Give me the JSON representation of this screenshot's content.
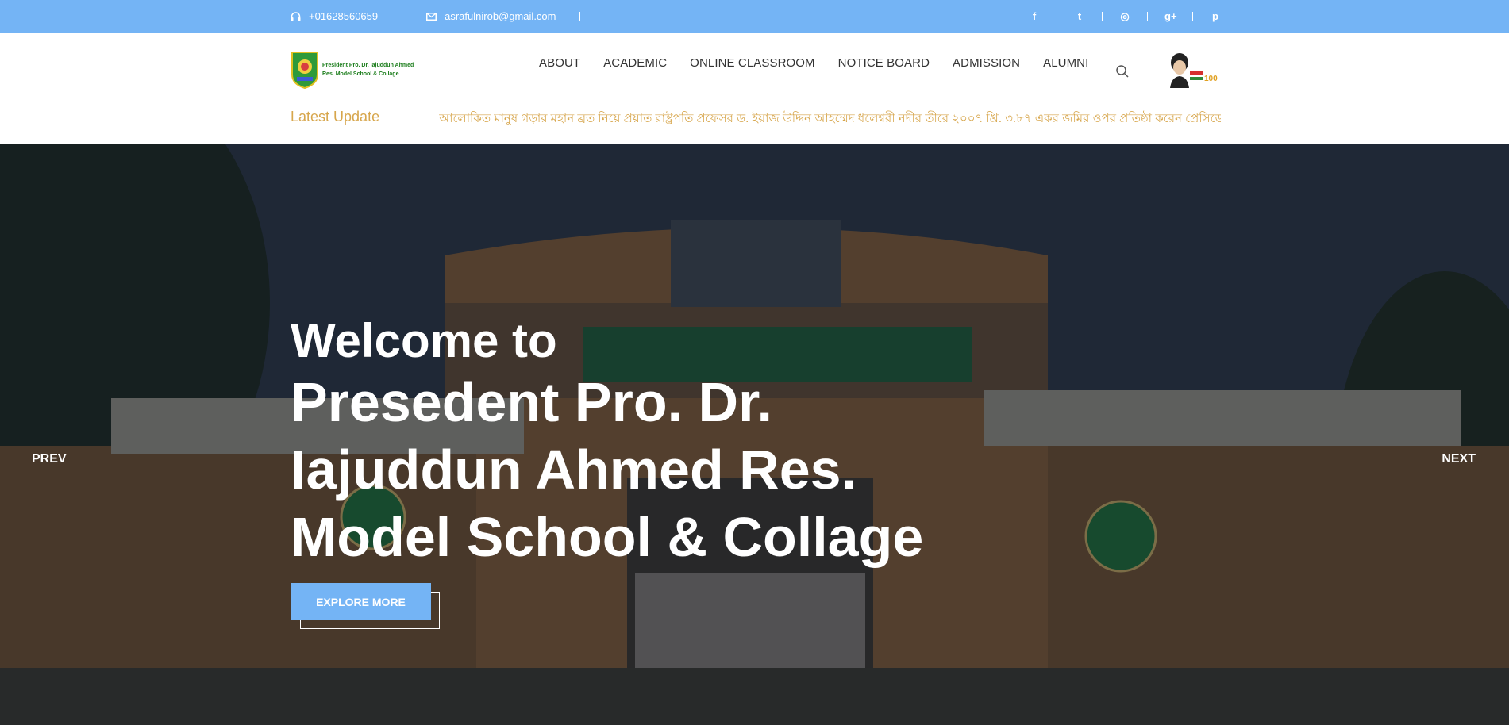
{
  "topbar": {
    "phone": "+01628560659",
    "email": "asrafulnirob@gmail.com",
    "social": [
      {
        "icon": "facebook-icon",
        "glyph": "f"
      },
      {
        "icon": "twitter-icon",
        "glyph": "t"
      },
      {
        "icon": "dribbble-icon",
        "glyph": "◎"
      },
      {
        "icon": "google-plus-icon",
        "glyph": "g+"
      },
      {
        "icon": "pinterest-icon",
        "glyph": "p"
      }
    ]
  },
  "header": {
    "logo_text_line1": "President Pro. Dr. Iajuddun Ahmed",
    "logo_text_line2": "Res. Model School & Collage",
    "nav": [
      "ABOUT",
      "ACADEMIC",
      "ONLINE CLASSROOM",
      "NOTICE BOARD",
      "ADMISSION",
      "ALUMNI"
    ],
    "latest_label": "Latest Update",
    "latest_text": "আলোকিত মানুষ গড়ার মহান ব্রত নিয়ে প্রয়াত রাষ্ট্রপতি প্রফেসর ড. ইয়াজ উদ্দিন আহম্মেদ ধলেশ্বরী নদীর তীরে ২০০৭ খ্রি. ৩.৮৭ একর জমির ওপর প্রতিষ্ঠা করেন প্রেসিডেন্ট"
  },
  "hero": {
    "welcome": "Welcome to",
    "title": "Presedent Pro. Dr. Iajuddun Ahmed Res. Model School & Collage",
    "explore_label": "EXPLORE MORE",
    "prev_label": "PREV",
    "next_label": "NEXT"
  },
  "colors": {
    "accent": "#74b4f5",
    "latest": "#d7a64c",
    "logo_green": "#1b7d1b"
  }
}
